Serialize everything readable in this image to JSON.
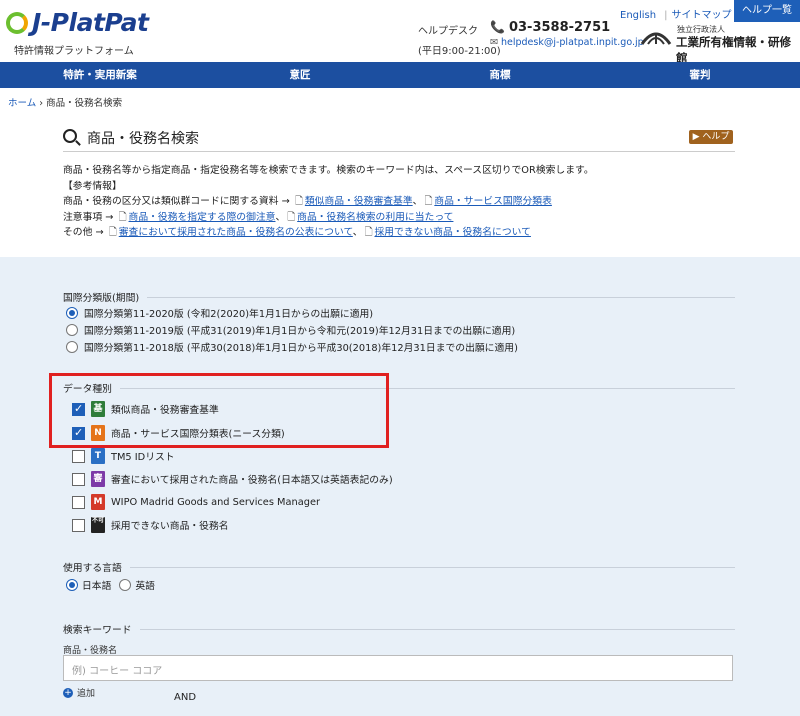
{
  "header": {
    "logo_text": "J-PlatPat",
    "logo_sub": "特許情報プラットフォーム",
    "links": {
      "english": "English",
      "sitemap": "サイトマップ",
      "help_list": "ヘルプ一覧"
    },
    "helpdesk_label": "ヘルプデスク",
    "helpdesk_hours": "(平日9:00-21:00)",
    "phone": "03-3588-2751",
    "mail": "helpdesk@j-platpat.inpit.go.jp",
    "inpit_small": "独立行政法人",
    "inpit_name": "工業所有権情報・研修館"
  },
  "nav": [
    "特許・実用新案",
    "意匠",
    "商標",
    "審判"
  ],
  "breadcrumb": {
    "home": "ホーム",
    "sep": "›",
    "current": "商品・役務名検索"
  },
  "title": "商品・役務名検索",
  "help_button": "▶ ヘルプ",
  "description": {
    "line1": "商品・役務名等から指定商品・指定役務名等を検索できます。検索のキーワード内は、スペース区切りでOR検索します。",
    "line2": "【参考情報】",
    "line3_prefix": "商品・役務の区分又は類似群コードに関する資料 →",
    "line3_link1": "類似商品・役務審査基準",
    "line3_link2": "商品・サービス国際分類表",
    "line4_prefix": "注意事項 →",
    "line4_link1": "商品・役務を指定する際の御注意",
    "line4_link2": "商品・役務名検索の利用に当たって",
    "line5_prefix": "その他 →",
    "line5_link1": "審査において採用された商品・役務名の公表について",
    "line5_link2": "採用できない商品・役務名について"
  },
  "classification": {
    "heading": "国際分類版(期間)",
    "options": [
      {
        "label": "国際分類第11-2020版 (令和2(2020)年1月1日からの出願に適用)",
        "selected": true
      },
      {
        "label": "国際分類第11-2019版 (平成31(2019)年1月1日から令和元(2019)年12月31日までの出願に適用)",
        "selected": false
      },
      {
        "label": "国際分類第11-2018版 (平成30(2018)年1月1日から平成30(2018)年12月31日までの出願に適用)",
        "selected": false
      }
    ]
  },
  "data_types": {
    "heading": "データ種別",
    "items": [
      {
        "badge": "基",
        "badge_color": "#2f7d3a",
        "label": "類似商品・役務審査基準",
        "checked": true
      },
      {
        "badge": "N",
        "badge_color": "#e5741a",
        "label": "商品・サービス国際分類表(ニース分類)",
        "checked": true
      },
      {
        "badge": "T",
        "badge_color": "#2a6fc4",
        "label": "TM5 IDリスト",
        "checked": false
      },
      {
        "badge": "審",
        "badge_color": "#7d3aa8",
        "label": "審査において採用された商品・役務名(日本語又は英語表記のみ)",
        "checked": false
      },
      {
        "badge": "M",
        "badge_color": "#d43a2a",
        "label": "WIPO Madrid Goods and Services Manager",
        "checked": false
      },
      {
        "badge": "不可",
        "badge_color": "#222222",
        "label": "採用できない商品・役務名",
        "checked": false
      }
    ]
  },
  "language": {
    "heading": "使用する言語",
    "options": [
      {
        "label": "日本語",
        "selected": true
      },
      {
        "label": "英語",
        "selected": false
      }
    ]
  },
  "keyword": {
    "heading": "検索キーワード",
    "field_label": "商品・役務名",
    "placeholder": "例) コーヒー ココア",
    "add_label": "追加",
    "and_label": "AND"
  }
}
